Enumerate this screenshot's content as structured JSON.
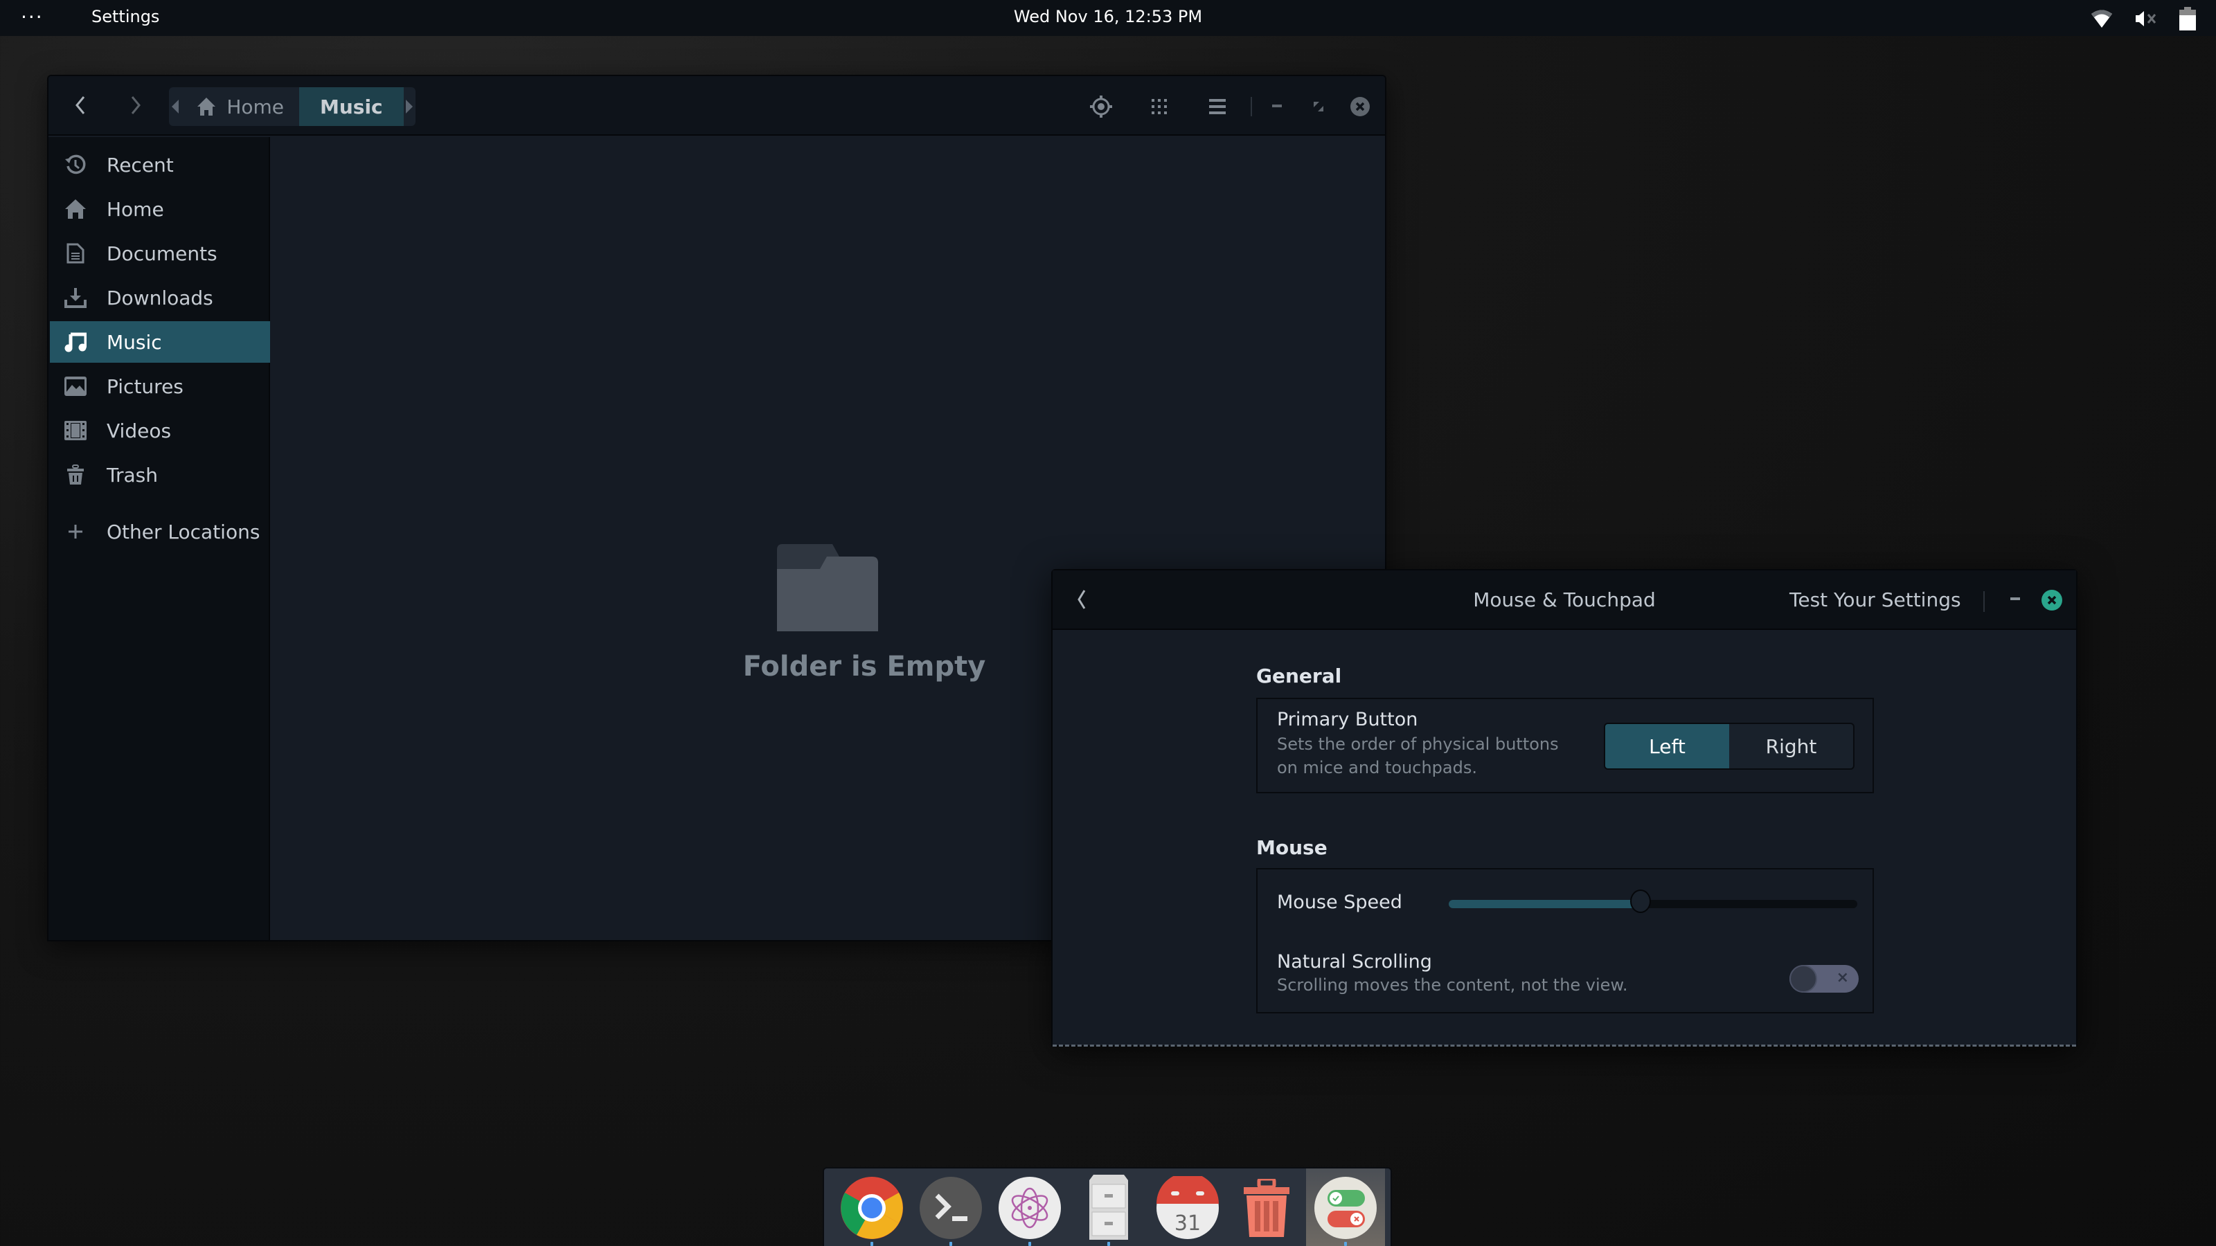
{
  "topbar": {
    "menu_icon": "ellipsis-icon",
    "app_name": "Settings",
    "clock": "Wed Nov 16, 12:53 PM",
    "tray": [
      "wifi-icon",
      "volume-muted-icon",
      "battery-icon"
    ]
  },
  "files_window": {
    "nav": {
      "back_icon": "chevron-left-icon",
      "forward_icon": "chevron-right-icon"
    },
    "pathbar": [
      {
        "label": "Home",
        "icon": "home-icon",
        "active": false
      },
      {
        "label": "Music",
        "active": true
      }
    ],
    "header_icons": [
      "locate-icon",
      "grid-view-icon",
      "menu-icon",
      "minimize-icon",
      "restore-icon",
      "close-icon"
    ],
    "sidebar": {
      "items": [
        {
          "label": "Recent",
          "icon": "clock-icon"
        },
        {
          "label": "Home",
          "icon": "home-icon"
        },
        {
          "label": "Documents",
          "icon": "document-icon"
        },
        {
          "label": "Downloads",
          "icon": "download-icon"
        },
        {
          "label": "Music",
          "icon": "music-note-icon",
          "active": true
        },
        {
          "label": "Pictures",
          "icon": "picture-icon"
        },
        {
          "label": "Videos",
          "icon": "film-icon"
        },
        {
          "label": "Trash",
          "icon": "trash-icon"
        },
        {
          "label": "Other Locations",
          "icon": "plus-icon"
        }
      ]
    },
    "empty_state": {
      "icon": "folder-icon",
      "label": "Folder is Empty"
    }
  },
  "settings_window": {
    "title": "Mouse & Touchpad",
    "test_button": "Test Your Settings",
    "general": {
      "heading": "General",
      "primary_button": {
        "title": "Primary Button",
        "description_line1": "Sets the order of physical buttons",
        "description_line2": "on mice and touchpads.",
        "options": [
          "Left",
          "Right"
        ],
        "selected": "Left"
      }
    },
    "mouse": {
      "heading": "Mouse",
      "speed": {
        "label": "Mouse Speed",
        "value_percent": 47
      },
      "natural_scrolling": {
        "title": "Natural Scrolling",
        "description": "Scrolling moves the content, not the view.",
        "enabled": false
      }
    }
  },
  "dock": {
    "apps": [
      {
        "name": "Chrome",
        "icon": "chrome-icon"
      },
      {
        "name": "Terminal",
        "icon": "terminal-icon"
      },
      {
        "name": "Atom",
        "icon": "atom-icon"
      },
      {
        "name": "Files",
        "icon": "file-cabinet-icon"
      },
      {
        "name": "Calendar",
        "icon": "calendar-icon",
        "day": "31"
      },
      {
        "name": "Trash",
        "icon": "trash-icon"
      },
      {
        "name": "Settings",
        "icon": "settings-toggles-icon",
        "active": true
      }
    ]
  },
  "colors": {
    "accent": "#235463",
    "close_green": "#2aa58c",
    "window_bg": "#151b24",
    "header_bg": "#0c1015"
  }
}
